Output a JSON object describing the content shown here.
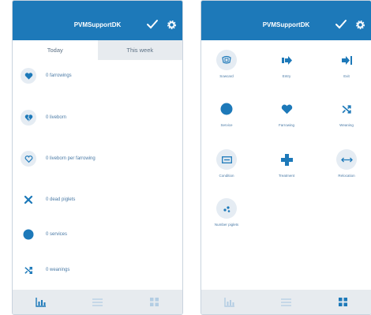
{
  "header": {
    "title": "PVMSupportDK"
  },
  "tabs": [
    {
      "label": "Today"
    },
    {
      "label": "This week"
    }
  ],
  "today_list": [
    {
      "label": "0 farrowings",
      "icon": "heart-icon"
    },
    {
      "label": "0 liveborn",
      "icon": "broken-heart-icon"
    },
    {
      "label": "0 liveborn per farrowing",
      "icon": "heart-outline-icon"
    },
    {
      "label": "0 dead piglets",
      "icon": "x-icon"
    },
    {
      "label": "0 services",
      "icon": "circle-icon"
    },
    {
      "label": "0 weanings",
      "icon": "shuffle-icon"
    }
  ],
  "actions": [
    {
      "label": "Sowcard",
      "icon": "sowcard-icon"
    },
    {
      "label": "Entry",
      "icon": "entry-icon"
    },
    {
      "label": "Exit",
      "icon": "exit-icon"
    },
    {
      "label": "Service",
      "icon": "service-icon"
    },
    {
      "label": "Farrowing",
      "icon": "heart-icon"
    },
    {
      "label": "Weaning",
      "icon": "shuffle-icon"
    },
    {
      "label": "Condition",
      "icon": "condition-icon"
    },
    {
      "label": "Treatment",
      "icon": "plus-icon"
    },
    {
      "label": "Relocation",
      "icon": "relocation-icon"
    },
    {
      "label": "Number piglets",
      "icon": "piglets-icon"
    }
  ],
  "colors": {
    "header": "#1d79b9",
    "icon": "#1d79b9",
    "nav_inactive": "#b3cde3",
    "label": "#4a7aa6"
  }
}
